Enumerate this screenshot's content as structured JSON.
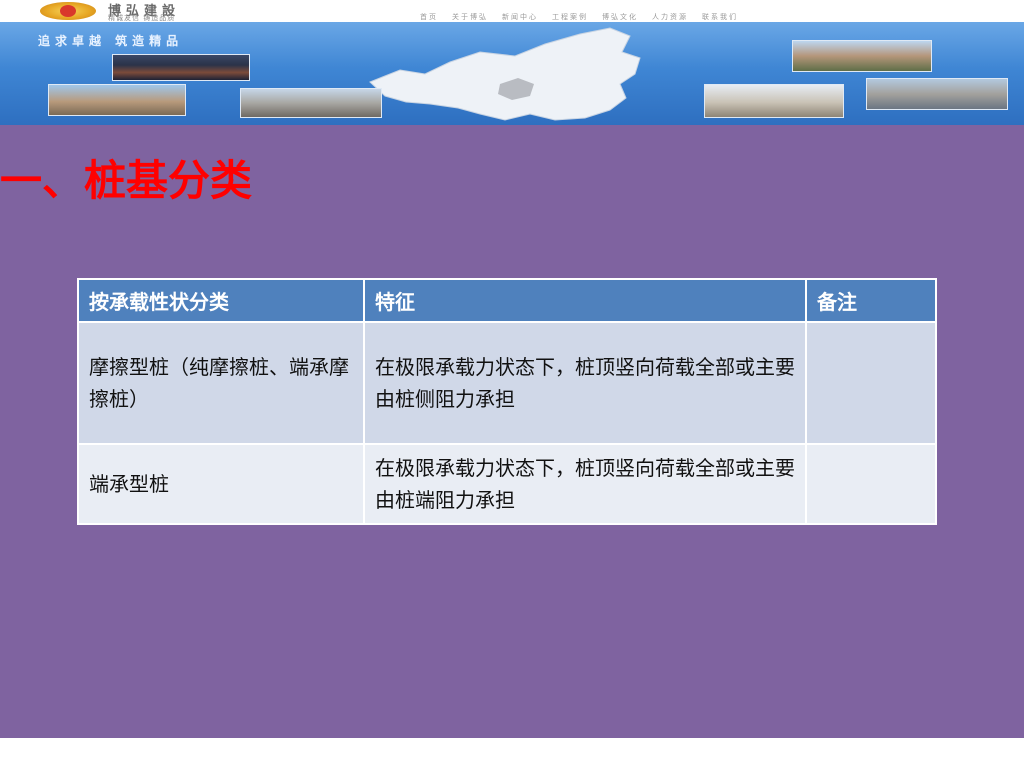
{
  "header": {
    "company_name": "博弘建設",
    "company_tagline": "精诚友信 铸造品质",
    "nav_items": [
      "首页",
      "关于博弘",
      "新闻中心",
      "工程案例",
      "博弘文化",
      "人力资源",
      "联系我们"
    ],
    "slogan": "追求卓越 筑造精品"
  },
  "slide": {
    "title": "一、桩基分类",
    "table": {
      "headers": [
        "按承载性状分类",
        "特征",
        "备注"
      ],
      "rows": [
        {
          "category": "摩擦型桩（纯摩擦桩、端承摩擦桩）",
          "feature": "在极限承载力状态下，桩顶竖向荷载全部或主要由桩侧阻力承担",
          "remark": ""
        },
        {
          "category": "端承型桩",
          "feature": "在极限承载力状态下，桩顶竖向荷载全部或主要由桩端阻力承担",
          "remark": ""
        }
      ]
    }
  },
  "colors": {
    "slide_background": "#7f63a0",
    "title_color": "#ff0000",
    "table_header": "#4f81bd",
    "row_odd": "#d0d8e8",
    "row_even": "#e9edf4",
    "banner_blue": "#3f86d4"
  }
}
